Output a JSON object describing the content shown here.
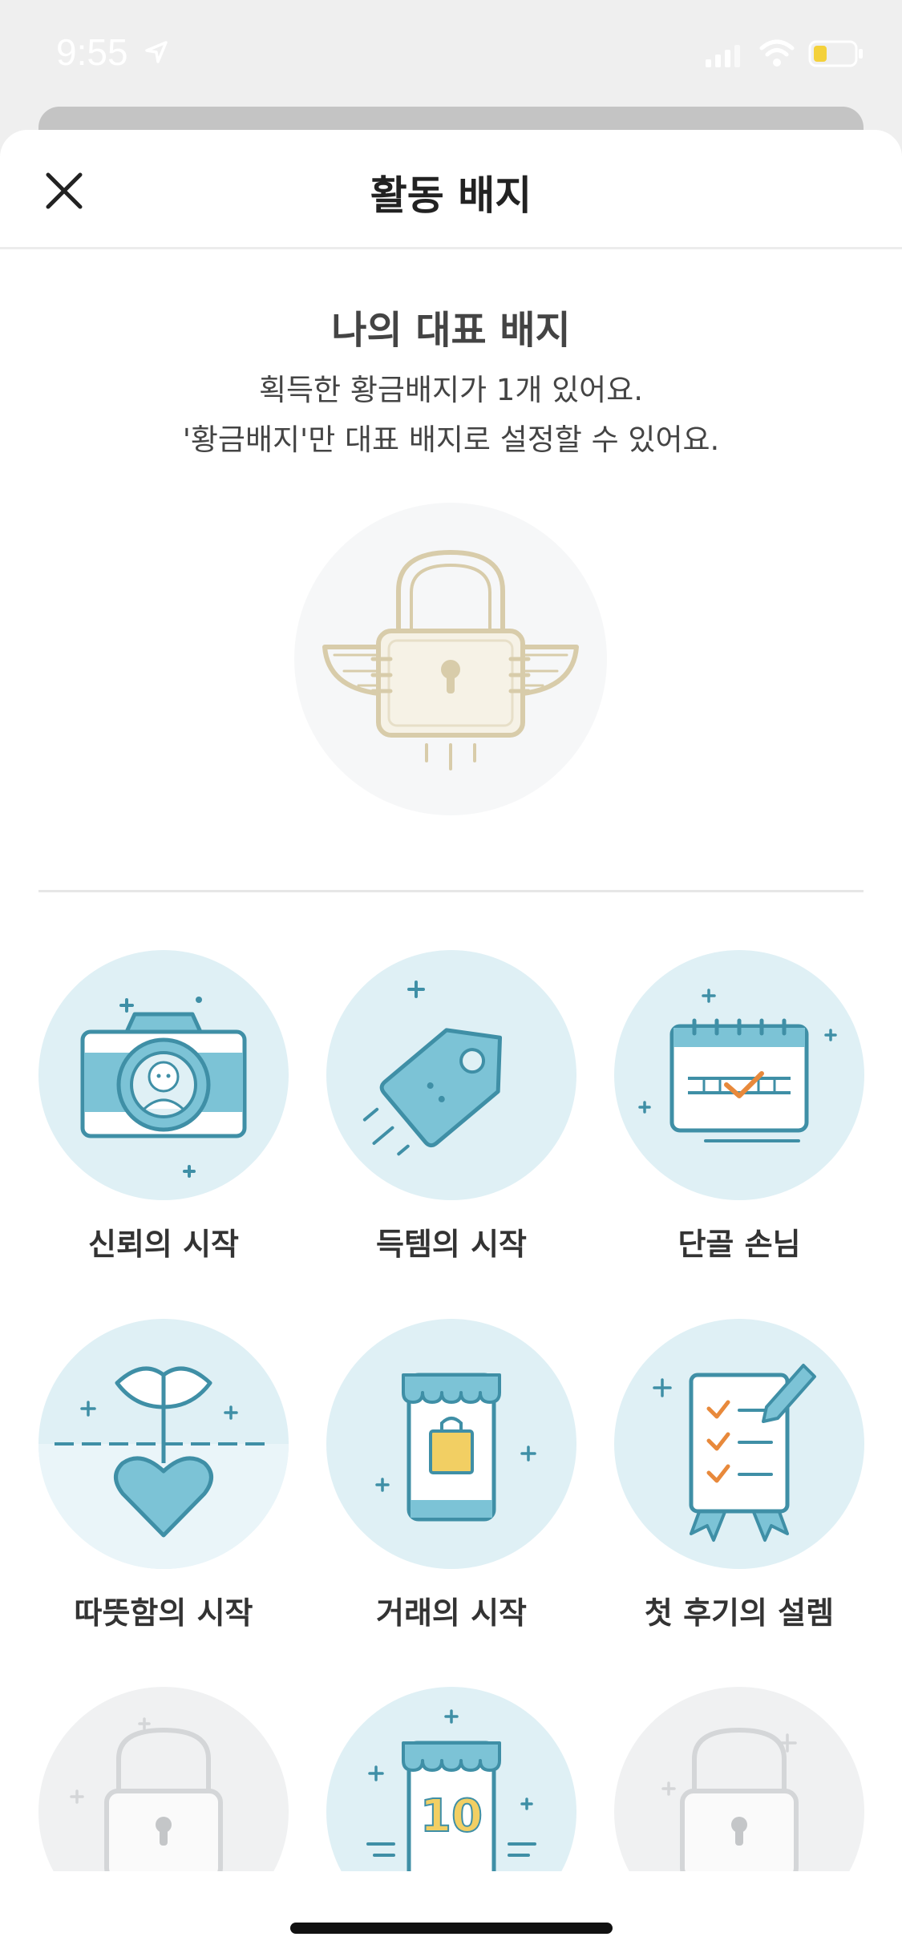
{
  "status_bar": {
    "time": "9:55"
  },
  "header": {
    "title": "활동 배지"
  },
  "representative": {
    "title": "나의 대표 배지",
    "line1": "획득한 황금배지가 1개 있어요.",
    "line2": "'황금배지'만 대표 배지로 설정할 수 있어요."
  },
  "badges": [
    {
      "label": "신뢰의 시작",
      "icon": "camera-icon"
    },
    {
      "label": "득템의 시작",
      "icon": "price-tag-icon"
    },
    {
      "label": "단골 손님",
      "icon": "calendar-icon"
    },
    {
      "label": "따뜻함의 시작",
      "icon": "sprout-heart-icon"
    },
    {
      "label": "거래의 시작",
      "icon": "shop-phone-icon"
    },
    {
      "label": "첫 후기의 설렘",
      "icon": "review-checklist-icon"
    },
    {
      "label": "",
      "icon": "locked-badge-icon"
    },
    {
      "label": "",
      "icon": "shop-10-icon"
    },
    {
      "label": "",
      "icon": "locked-badge-icon"
    }
  ],
  "colors": {
    "badge_bg": "#dff0f5",
    "badge_blue": "#7cc3d6",
    "line": "#3f8fa6",
    "accent_orange": "#e8893b",
    "locked_gold": "#d8ccaa"
  }
}
